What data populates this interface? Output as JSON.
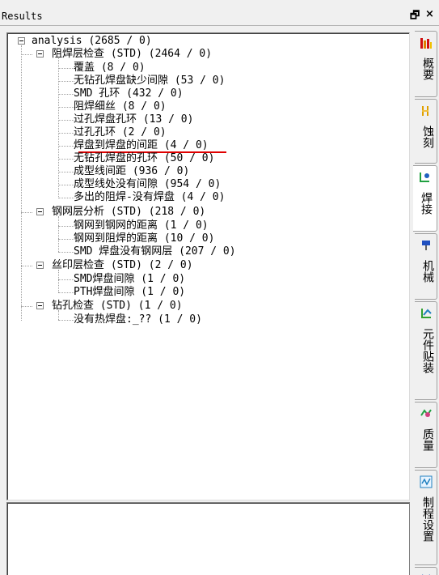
{
  "window": {
    "title": "Results",
    "pin_glyph": "🗗",
    "close_glyph": "×"
  },
  "tree": {
    "root": {
      "label": "analysis (2685 / 0)"
    },
    "groups": [
      {
        "label": "阻焊层检查 (STD) (2464 / 0)",
        "items": [
          "覆盖 (8 / 0)",
          "无钻孔焊盘缺少间隙 (53 / 0)",
          "SMD 孔环 (432 / 0)",
          "阻焊细丝 (8 / 0)",
          "过孔焊盘孔环 (13 / 0)",
          "过孔孔环 (2 / 0)",
          "焊盘到焊盘的间距 (4 / 0)",
          "无钻孔焊盘的孔环 (50 / 0)",
          "成型线间距 (936 / 0)",
          "成型线处没有间隙 (954 / 0)",
          "多出的阻焊-没有焊盘 (4 / 0)"
        ]
      },
      {
        "label": "钢网层分析 (STD) (218 / 0)",
        "items": [
          "钢网到钢网的距离 (1 / 0)",
          "钢网到阻焊的距离 (10 / 0)",
          "SMD 焊盘没有钢网层 (207 / 0)"
        ]
      },
      {
        "label": "丝印层检查 (STD) (2 / 0)",
        "items": [
          "SMD焊盘间隙 (1 / 0)",
          "PTH焊盘间隙 (1 / 0)"
        ]
      },
      {
        "label": "钻孔检查 (STD) (1 / 0)",
        "items": [
          "没有热焊盘:_?? (1 / 0)"
        ]
      }
    ]
  },
  "tabs": [
    {
      "label": "概要",
      "icon": "bar-chart-icon",
      "color": "#d01010"
    },
    {
      "label": "蚀刻",
      "icon": "etch-icon",
      "color": "#e0a000"
    },
    {
      "label": "焊接",
      "icon": "solder-icon",
      "color": "#2060c0"
    },
    {
      "label": "机械",
      "icon": "drill-icon",
      "color": "#2050c0"
    },
    {
      "label": "元件贴装",
      "icon": "component-icon",
      "color": "#30a030"
    },
    {
      "label": "质量",
      "icon": "quality-icon",
      "color": "#20a040"
    },
    {
      "label": "制程设置",
      "icon": "process-icon",
      "color": "#2080c0"
    },
    {
      "label": "",
      "icon": "settings-icon",
      "color": "#3060c0"
    }
  ]
}
